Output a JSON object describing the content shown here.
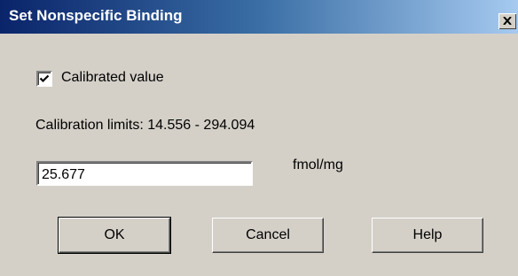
{
  "window": {
    "title": "Set Nonspecific Binding",
    "close_glyph": "×"
  },
  "calibrated": {
    "label": "Calibrated value",
    "checked": true,
    "icon": "checkmark-icon"
  },
  "limits": {
    "text": "Calibration limits: 14.556 - 294.094"
  },
  "value_field": {
    "value": "25.677",
    "unit": "fmol/mg"
  },
  "buttons": {
    "ok": "OK",
    "cancel": "Cancel",
    "help": "Help"
  },
  "colors": {
    "titlebar_start": "#0a246a",
    "titlebar_end": "#a6caf0",
    "dialog_bg": "#d4d0c8"
  }
}
